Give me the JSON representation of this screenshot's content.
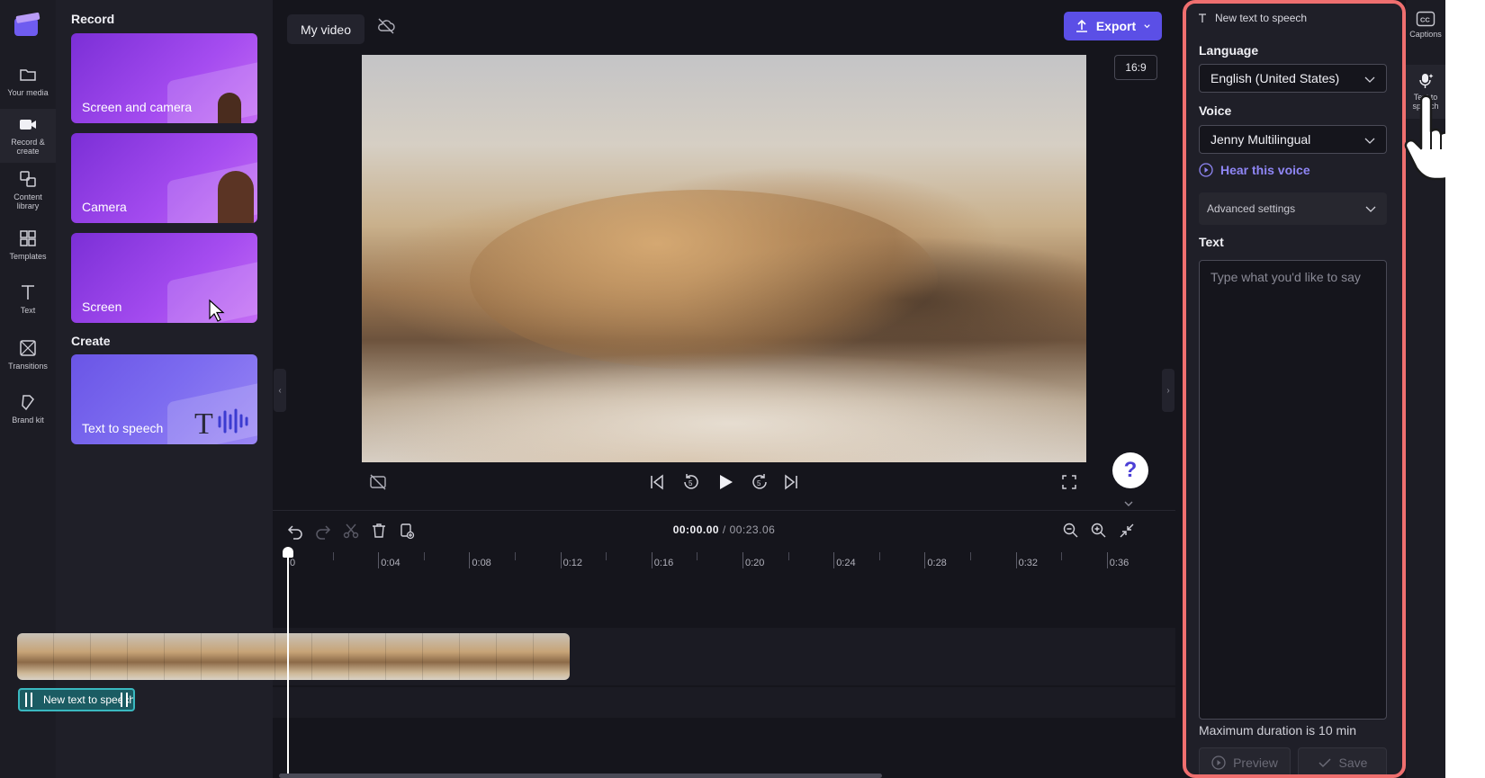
{
  "nav": {
    "items": [
      {
        "label": "Your media",
        "icon": "folder-icon"
      },
      {
        "label": "Record & create",
        "icon": "camera-icon"
      },
      {
        "label": "Content library",
        "icon": "content-library-icon"
      },
      {
        "label": "Templates",
        "icon": "templates-icon"
      },
      {
        "label": "Text",
        "icon": "text-icon"
      },
      {
        "label": "Transitions",
        "icon": "transitions-icon"
      },
      {
        "label": "Brand kit",
        "icon": "brand-kit-icon"
      }
    ]
  },
  "panel": {
    "record_heading": "Record",
    "create_heading": "Create",
    "cards": [
      {
        "label": "Screen and camera"
      },
      {
        "label": "Camera"
      },
      {
        "label": "Screen"
      },
      {
        "label": "Text to speech"
      }
    ]
  },
  "topbar": {
    "project_name": "My video",
    "export_label": "Export",
    "aspect_ratio": "16:9"
  },
  "timeline": {
    "current_time": "00:00.00",
    "total_time": "/ 00:23.06",
    "ticks": [
      "0",
      "0:04",
      "0:08",
      "0:12",
      "0:16",
      "0:20",
      "0:24",
      "0:28",
      "0:32",
      "0:36"
    ],
    "audio_clip_label": "New text to speech"
  },
  "tts": {
    "title": "New text to speech",
    "language_label": "Language",
    "language_value": "English (United States)",
    "voice_label": "Voice",
    "voice_value": "Jenny Multilingual",
    "hear_voice": "Hear this voice",
    "advanced_settings": "Advanced settings",
    "text_label": "Text",
    "text_placeholder": "Type what you'd like to say",
    "max_duration": "Maximum duration is 10 min",
    "preview_label": "Preview",
    "save_label": "Save"
  },
  "rail": {
    "captions_label": "Captions",
    "tts_label": "Text to speech"
  },
  "help": {
    "symbol": "?"
  },
  "colors": {
    "accent": "#5b4fe6",
    "highlight_outline": "#ef6f6f",
    "link": "#8f86f5",
    "audio_clip": "#1b5c63"
  }
}
